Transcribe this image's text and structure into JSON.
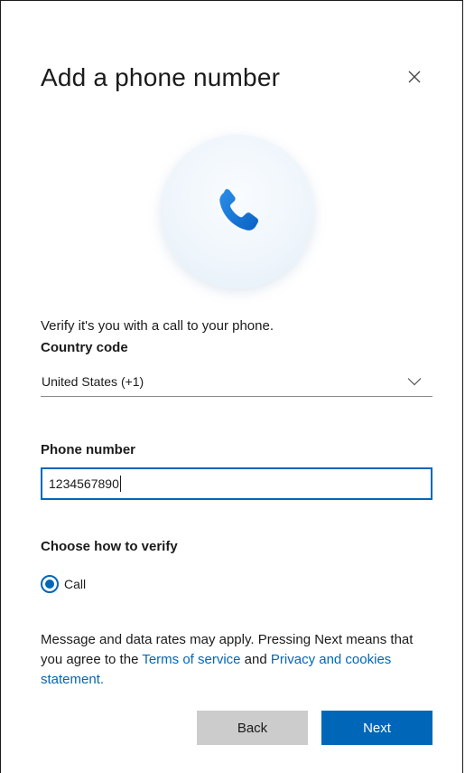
{
  "dialog": {
    "title": "Add a phone number",
    "close_icon": "close-icon",
    "hero_icon": "phone-icon",
    "lead_text": "Verify it's you with a call to your phone."
  },
  "country": {
    "label": "Country code",
    "value": "United States (+1)",
    "icon": "chevron-down-icon"
  },
  "phone": {
    "label": "Phone number",
    "value": "1234567890"
  },
  "verify": {
    "label": "Choose how to verify",
    "options": [
      {
        "label": "Call",
        "selected": true
      }
    ]
  },
  "fine_print": {
    "text_before": "Message and data rates may apply. Pressing Next means that you agree to the ",
    "terms_link": "Terms of service",
    "text_middle": " and ",
    "privacy_link": "Privacy and cookies statement."
  },
  "buttons": {
    "back": "Back",
    "next": "Next"
  },
  "colors": {
    "accent": "#0067b8",
    "secondary_button": "#cccccc",
    "text": "#1b1b1b"
  }
}
